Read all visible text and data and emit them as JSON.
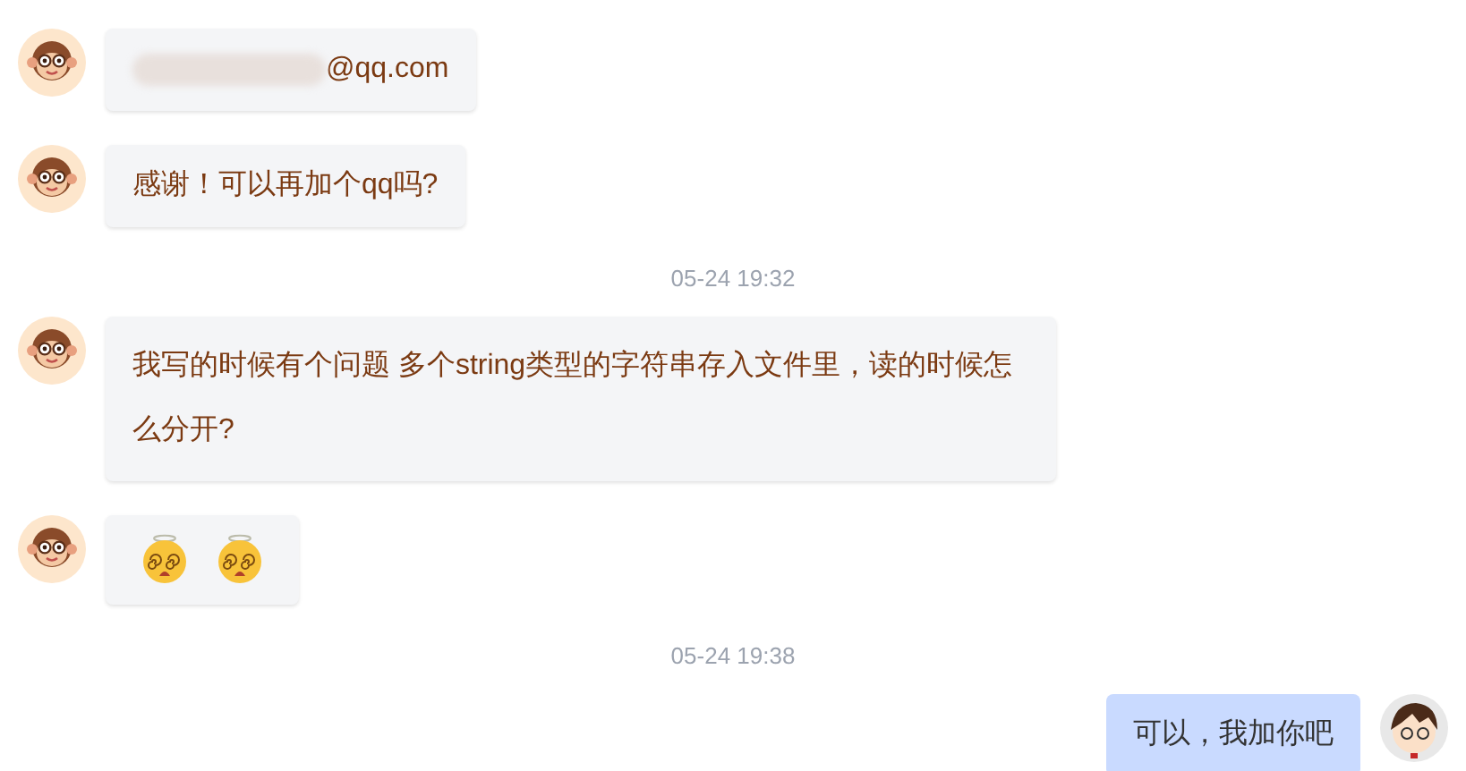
{
  "messages": [
    {
      "kind": "incoming-text",
      "text": "@qq.com",
      "blurred_prefix": true
    },
    {
      "kind": "incoming-text",
      "text": "感谢！可以再加个qq吗?"
    },
    {
      "kind": "timestamp",
      "text": "05-24 19:32"
    },
    {
      "kind": "incoming-text",
      "text": "我写的时候有个问题 多个string类型的字符串存入文件里，读的时候怎么分开?"
    },
    {
      "kind": "incoming-stickers",
      "stickers": [
        {
          "kind": "dizzy-face"
        },
        {
          "kind": "dizzy-face"
        }
      ]
    },
    {
      "kind": "timestamp",
      "text": "05-24 19:38"
    },
    {
      "kind": "outgoing-text",
      "text": "可以，我加你吧"
    }
  ]
}
